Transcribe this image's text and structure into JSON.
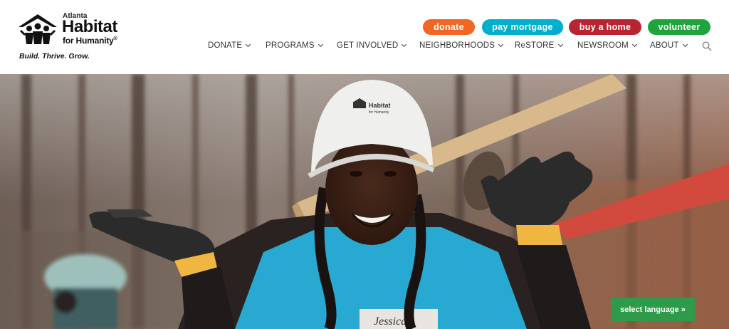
{
  "brand": {
    "city": "Atlanta",
    "name": "Habitat",
    "suffix": "for Humanity",
    "registered": "®",
    "tagline": "Build. Thrive. Grow."
  },
  "actions": {
    "donate": "donate",
    "pay_mortgage": "pay mortgage",
    "buy_home": "buy a home",
    "volunteer": "volunteer"
  },
  "nav": {
    "donate": "DONATE",
    "programs": "PROGRAMS",
    "get_involved": "GET INVOLVED",
    "neighborhoods": "NEIGHBORHOODS",
    "restore": "ReSTORE",
    "newsroom": "NEWSROOM",
    "about": "ABOUT"
  },
  "hero": {
    "helmet_line1": "Habitat",
    "helmet_line2": "for Humanity",
    "name_tag": "Jessica"
  },
  "language": {
    "label": "select language »"
  },
  "colors": {
    "donate": "#f26522",
    "pay_mortgage": "#00aecd",
    "buy_home": "#b82531",
    "volunteer": "#1fa33c",
    "language": "#2e9a4a"
  }
}
